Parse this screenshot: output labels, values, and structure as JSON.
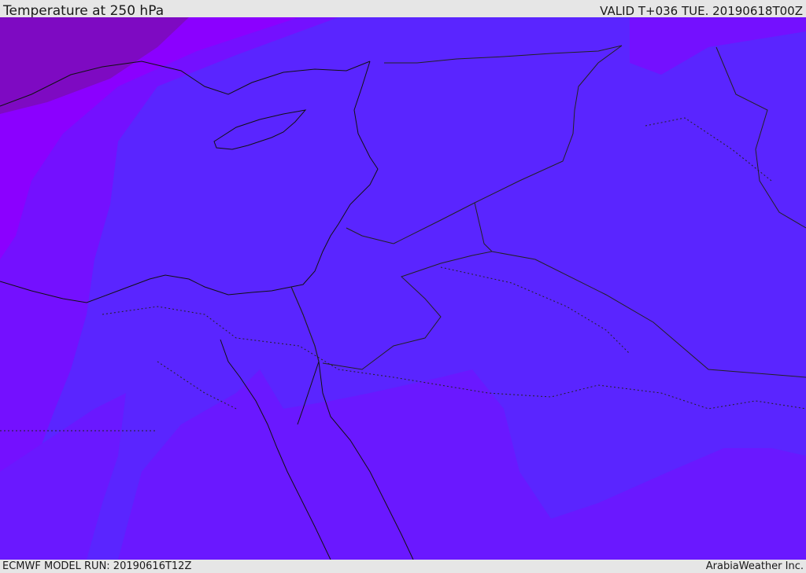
{
  "header": {
    "title": "Temperature at 250 hPa",
    "valid_time": "VALID T+036 TUE. 20190618T00Z"
  },
  "footer": {
    "model_run": "ECMWF MODEL RUN: 20190616T12Z",
    "credit": "ArabiaWeather Inc."
  },
  "map": {
    "field": "temperature",
    "pressure_level_hpa": 250,
    "colors": {
      "coldest": "#7e0ac2",
      "cold": "#8b00ff",
      "cool": "#7410ff",
      "base": "#5a25ff",
      "warm": "#6a18ff",
      "coastline": "#111111",
      "border": "#222222"
    }
  }
}
